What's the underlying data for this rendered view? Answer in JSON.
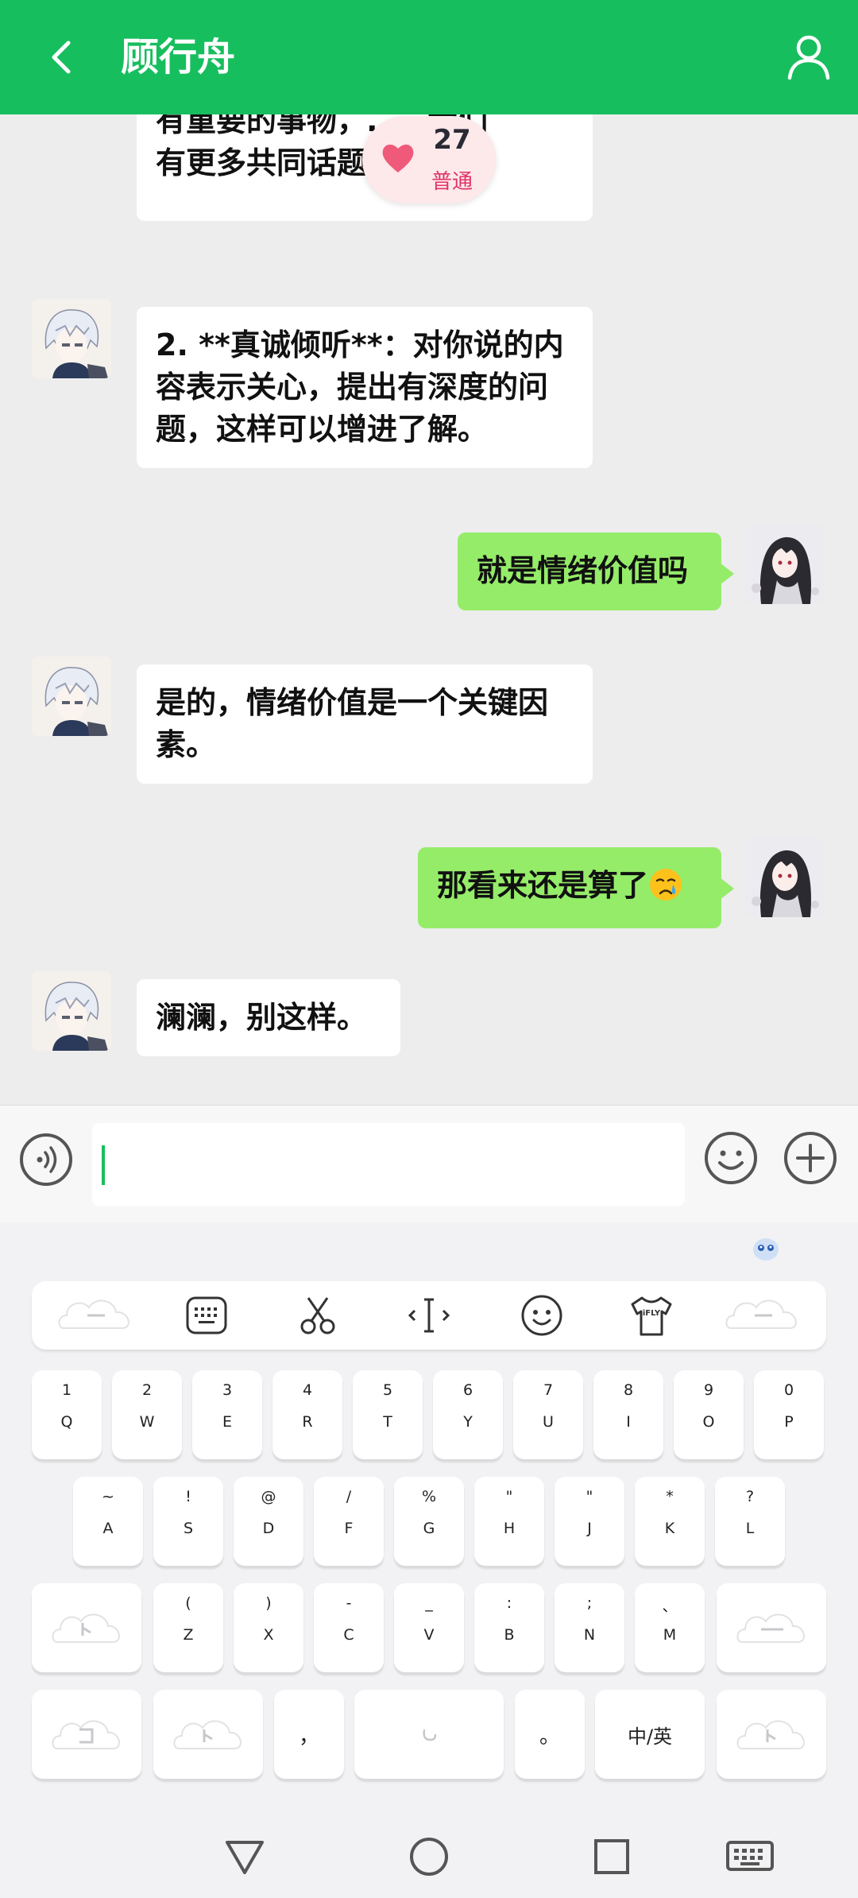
{
  "header": {
    "title": "顾行舟",
    "back_icon": "chevron-left-icon",
    "profile_icon": "person-icon"
  },
  "badge": {
    "count": "27",
    "level": "普通",
    "icon": "heart-icon"
  },
  "messages": [
    {
      "side": "left",
      "text": "有更多共同话题。",
      "partial_top": "有重要的事物，……我们"
    },
    {
      "side": "left",
      "text": "2. **真诚倾听**：对你说的内容表示关心，提出有深度的问题，这样可以增进了解。"
    },
    {
      "side": "right",
      "text": "就是情绪价值吗"
    },
    {
      "side": "left",
      "text": "是的，情绪价值是一个关键因素。"
    },
    {
      "side": "right",
      "text": "那看来还是算了",
      "emoji": "crying-face"
    },
    {
      "side": "left",
      "text": "澜澜，别这样。"
    }
  ],
  "input": {
    "placeholder": "",
    "value": ""
  },
  "keyboard": {
    "row1": [
      {
        "sym": "1",
        "ltr": "Q"
      },
      {
        "sym": "2",
        "ltr": "W"
      },
      {
        "sym": "3",
        "ltr": "E"
      },
      {
        "sym": "4",
        "ltr": "R"
      },
      {
        "sym": "5",
        "ltr": "T"
      },
      {
        "sym": "6",
        "ltr": "Y"
      },
      {
        "sym": "7",
        "ltr": "U"
      },
      {
        "sym": "8",
        "ltr": "I"
      },
      {
        "sym": "9",
        "ltr": "O"
      },
      {
        "sym": "0",
        "ltr": "P"
      }
    ],
    "row2": [
      {
        "sym": "~",
        "ltr": "A"
      },
      {
        "sym": "!",
        "ltr": "S"
      },
      {
        "sym": "@",
        "ltr": "D"
      },
      {
        "sym": "/",
        "ltr": "F"
      },
      {
        "sym": "%",
        "ltr": "G"
      },
      {
        "sym": "\"",
        "ltr": "H"
      },
      {
        "sym": "\"",
        "ltr": "J"
      },
      {
        "sym": "*",
        "ltr": "K"
      },
      {
        "sym": "?",
        "ltr": "L"
      }
    ],
    "row3": [
      {
        "sym": "(",
        "ltr": "Z"
      },
      {
        "sym": ")",
        "ltr": "X"
      },
      {
        "sym": "-",
        "ltr": "C"
      },
      {
        "sym": "_",
        "ltr": "V"
      },
      {
        "sym": ":",
        "ltr": "B"
      },
      {
        "sym": ";",
        "ltr": "N"
      },
      {
        "sym": "、",
        "ltr": "M"
      }
    ],
    "comma": "，",
    "period": "。",
    "lang_switch": "中/英",
    "toolbar_icons": [
      "keyboard-icon",
      "scissors-icon",
      "text-cursor-icon",
      "smiley-icon",
      "shirt-icon"
    ],
    "shirt_label": "iFLY"
  },
  "navbar": {
    "icons": [
      "back-triangle-icon",
      "home-circle-icon",
      "recents-square-icon",
      "keyboard-hide-icon"
    ]
  }
}
